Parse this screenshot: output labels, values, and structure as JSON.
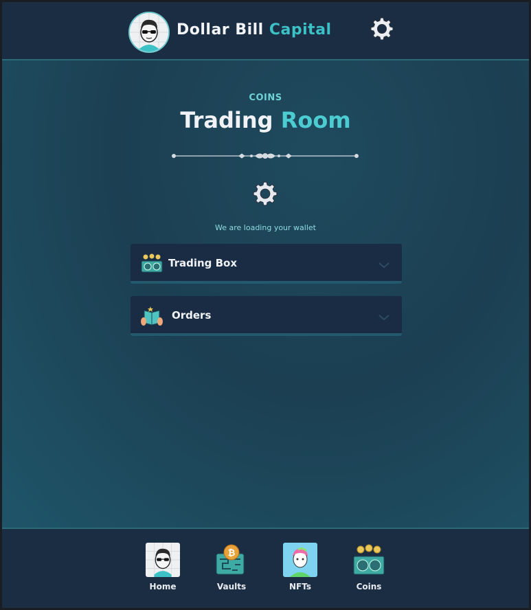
{
  "header": {
    "brand_primary": "Dollar Bill",
    "brand_accent": "Capital",
    "avatar_icon": "avatar-sunglasses-icon",
    "settings_icon": "gear-icon"
  },
  "main": {
    "kicker": "COINS",
    "title_primary": "Trading",
    "title_accent": "Room",
    "divider_icon": "ornamental-divider-icon",
    "loading_icon": "gear-icon",
    "loading_text": "We are loading your wallet",
    "sections": [
      {
        "label": "Trading Box",
        "icon": "mining-rig-coins-icon"
      },
      {
        "label": "Orders",
        "icon": "ledger-book-hands-icon"
      }
    ]
  },
  "nav": {
    "items": [
      {
        "label": "Home",
        "icon": "avatar-sunglasses-icon"
      },
      {
        "label": "Vaults",
        "icon": "bitcoin-vault-icon"
      },
      {
        "label": "NFTs",
        "icon": "nft-character-icon"
      },
      {
        "label": "Coins",
        "icon": "mining-rig-coins-icon"
      }
    ]
  },
  "colors": {
    "header_bg": "#1b2d43",
    "accent": "#3cc1c6",
    "panel_bg": "#1a2c43",
    "main_bg": "#1f4a5e"
  }
}
